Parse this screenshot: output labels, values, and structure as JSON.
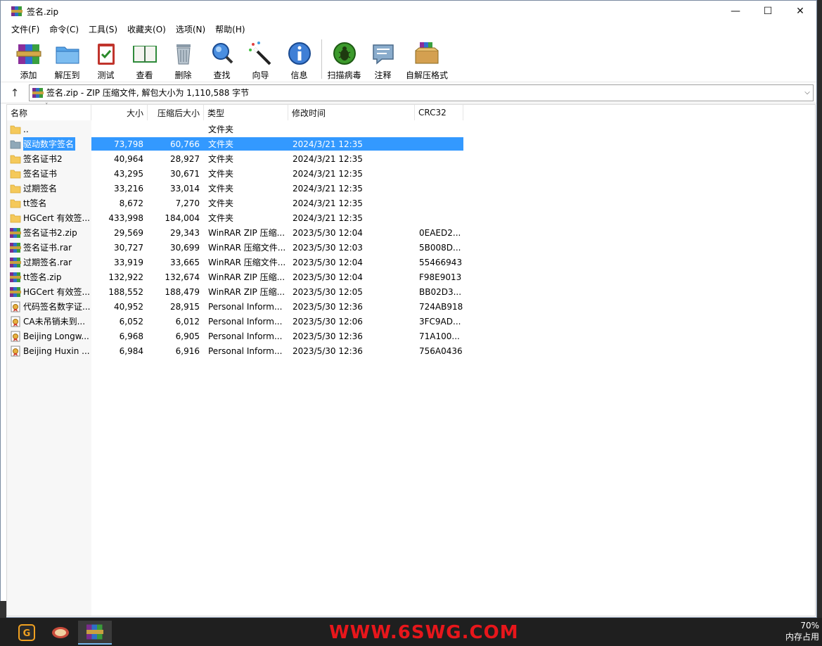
{
  "window": {
    "title": "签名.zip",
    "minimize": "—",
    "maximize": "☐",
    "close": "✕"
  },
  "menu": [
    "文件(F)",
    "命令(C)",
    "工具(S)",
    "收藏夹(O)",
    "选项(N)",
    "帮助(H)"
  ],
  "toolbar": {
    "add": "添加",
    "extract": "解压到",
    "test": "测试",
    "view": "查看",
    "delete": "删除",
    "find": "查找",
    "wizard": "向导",
    "info": "信息",
    "scan": "扫描病毒",
    "comment": "注释",
    "sfx": "自解压格式"
  },
  "address": {
    "up": "↑",
    "text": "签名.zip - ZIP 压缩文件, 解包大小为 1,110,588 字节",
    "dropdown": "⌵"
  },
  "columns": {
    "name": "名称",
    "size": "大小",
    "packed": "压缩后大小",
    "type": "类型",
    "modified": "修改时间",
    "crc": "CRC32",
    "sort": "˅"
  },
  "files": [
    {
      "icon": "folder",
      "name": "..",
      "size": "",
      "packed": "",
      "type": "文件夹",
      "modified": "",
      "crc": ""
    },
    {
      "icon": "folder-selected",
      "name": "驱动数字签名",
      "size": "73,798",
      "packed": "60,766",
      "type": "文件夹",
      "modified": "2024/3/21 12:35",
      "crc": ""
    },
    {
      "icon": "folder",
      "name": "签名证书2",
      "size": "40,964",
      "packed": "28,927",
      "type": "文件夹",
      "modified": "2024/3/21 12:35",
      "crc": ""
    },
    {
      "icon": "folder",
      "name": "签名证书",
      "size": "43,295",
      "packed": "30,671",
      "type": "文件夹",
      "modified": "2024/3/21 12:35",
      "crc": ""
    },
    {
      "icon": "folder",
      "name": "过期签名",
      "size": "33,216",
      "packed": "33,014",
      "type": "文件夹",
      "modified": "2024/3/21 12:35",
      "crc": ""
    },
    {
      "icon": "folder",
      "name": "tt签名",
      "size": "8,672",
      "packed": "7,270",
      "type": "文件夹",
      "modified": "2024/3/21 12:35",
      "crc": ""
    },
    {
      "icon": "folder",
      "name": "HGCert 有效签...",
      "size": "433,998",
      "packed": "184,004",
      "type": "文件夹",
      "modified": "2024/3/21 12:35",
      "crc": ""
    },
    {
      "icon": "archive",
      "name": "签名证书2.zip",
      "size": "29,569",
      "packed": "29,343",
      "type": "WinRAR ZIP 压缩...",
      "modified": "2023/5/30 12:04",
      "crc": "0EAED2..."
    },
    {
      "icon": "archive",
      "name": "签名证书.rar",
      "size": "30,727",
      "packed": "30,699",
      "type": "WinRAR 压缩文件...",
      "modified": "2023/5/30 12:03",
      "crc": "5B008D..."
    },
    {
      "icon": "archive",
      "name": "过期签名.rar",
      "size": "33,919",
      "packed": "33,665",
      "type": "WinRAR 压缩文件...",
      "modified": "2023/5/30 12:04",
      "crc": "55466943"
    },
    {
      "icon": "archive",
      "name": "tt签名.zip",
      "size": "132,922",
      "packed": "132,674",
      "type": "WinRAR ZIP 压缩...",
      "modified": "2023/5/30 12:04",
      "crc": "F98E9013"
    },
    {
      "icon": "archive",
      "name": "HGCert 有效签...",
      "size": "188,552",
      "packed": "188,479",
      "type": "WinRAR ZIP 压缩...",
      "modified": "2023/5/30 12:05",
      "crc": "BB02D3..."
    },
    {
      "icon": "cert",
      "name": "代码签名数字证...",
      "size": "40,952",
      "packed": "28,915",
      "type": "Personal Inform...",
      "modified": "2023/5/30 12:36",
      "crc": "724AB918"
    },
    {
      "icon": "cert",
      "name": "CA未吊销未到...",
      "size": "6,052",
      "packed": "6,012",
      "type": "Personal Inform...",
      "modified": "2023/5/30 12:06",
      "crc": "3FC9AD..."
    },
    {
      "icon": "cert",
      "name": "Beijing Longw...",
      "size": "6,968",
      "packed": "6,905",
      "type": "Personal Inform...",
      "modified": "2023/5/30 12:36",
      "crc": "71A100..."
    },
    {
      "icon": "cert",
      "name": "Beijing Huxin ...",
      "size": "6,984",
      "packed": "6,916",
      "type": "Personal Inform...",
      "modified": "2023/5/30 12:36",
      "crc": "756A0436"
    }
  ],
  "selected_index": 1,
  "taskbar": {
    "watermark": "WWW.6SWG.COM",
    "tray_line1": "70%",
    "tray_line2": "内存占用"
  }
}
